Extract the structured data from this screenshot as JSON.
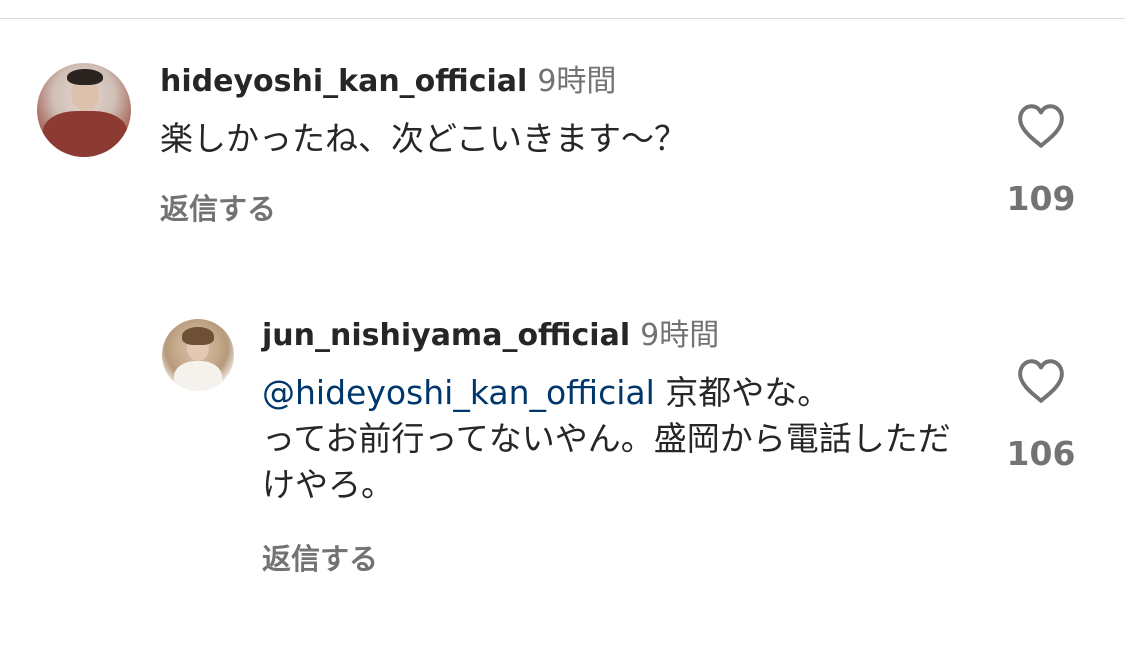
{
  "comments": [
    {
      "username": "hideyoshi_kan_official",
      "time": "9時間",
      "text": "楽しかったね、次どこいきます〜？",
      "reply_label": "返信する",
      "likes": "109",
      "avatar_icon": "profile-photo"
    },
    {
      "username": "jun_nishiyama_official",
      "time": "9時間",
      "mention": "@hideyoshi_kan_official",
      "text": " 京都やな。\nってお前行ってないやん。盛岡から電話しただけやろ。",
      "reply_label": "返信する",
      "likes": "106",
      "avatar_icon": "profile-photo"
    }
  ],
  "colors": {
    "text": "#262626",
    "secondary": "#737373",
    "mention": "#00376b",
    "divider": "#dbdbdb"
  },
  "icons": {
    "like": "heart-outline-icon"
  }
}
